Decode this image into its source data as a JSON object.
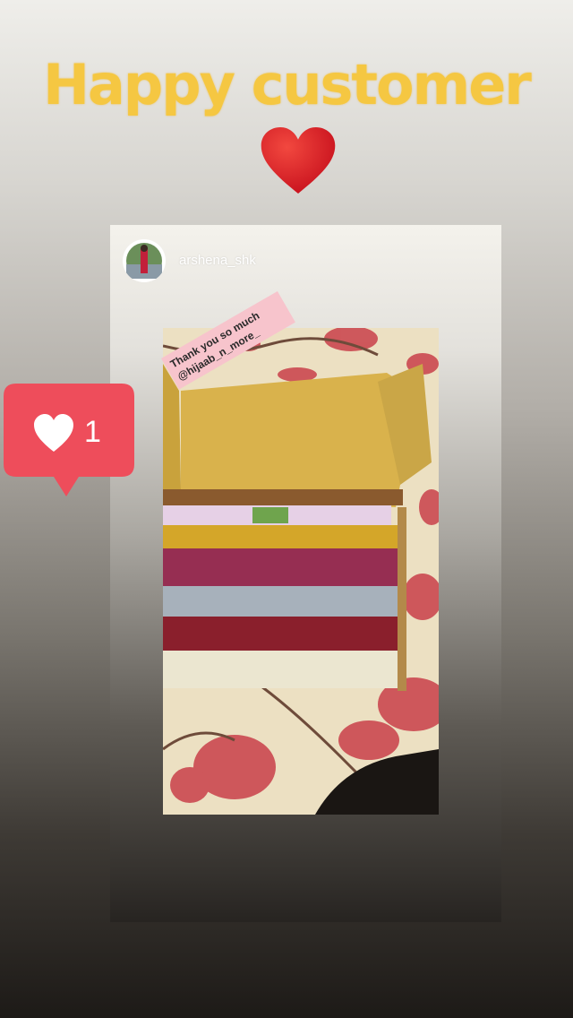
{
  "story": {
    "title": "Happy customer",
    "heart_emoji": "heart-icon",
    "accent_color": "#f5c742"
  },
  "repost": {
    "username": "arshena_shk",
    "sticker_line1": "Thank you so much",
    "sticker_line2": "@hijaab_n_more_"
  },
  "like_sticker": {
    "count": "1",
    "color": "#ee4d5b"
  }
}
